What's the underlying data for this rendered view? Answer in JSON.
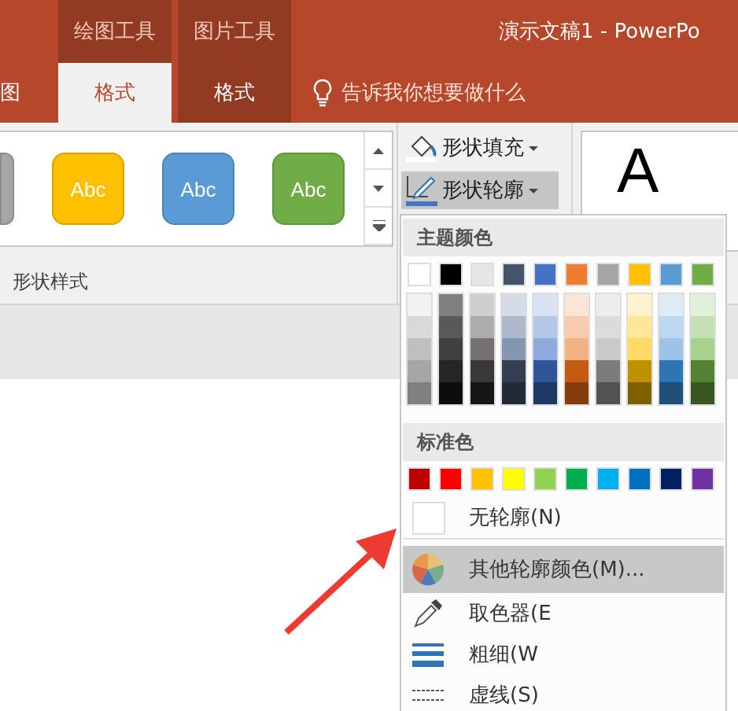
{
  "title_bar": {
    "tool_groups": [
      "绘图工具",
      "图片工具"
    ],
    "title": "演示文稿1  -  PowerPo"
  },
  "tabs": [
    {
      "label": "图",
      "selected": false,
      "kind": "plain"
    },
    {
      "label": "格式",
      "selected": true,
      "kind": "context"
    },
    {
      "label": "格式",
      "selected": false,
      "kind": "context"
    }
  ],
  "tell_me": {
    "placeholder": "告诉我你想要做什么"
  },
  "shape_styles": {
    "items": [
      {
        "color": "#a5a5a5"
      },
      {
        "label": "Abc",
        "color": "#ffc000"
      },
      {
        "label": "Abc",
        "color": "#5b9bd5"
      },
      {
        "label": "Abc",
        "color": "#70ad47"
      }
    ],
    "group_label": "形状样式"
  },
  "shape_buttons": [
    {
      "label": "形状填充",
      "kind": "fill",
      "selected": false
    },
    {
      "label": "形状轮廓",
      "kind": "outline",
      "selected": true
    }
  ],
  "wordart": [
    "A"
  ],
  "outline_menu": {
    "theme_header": "主题颜色",
    "theme_colors": [
      {
        "color": "#ffffff",
        "shades": [
          {
            "color": "#f2f2f2"
          },
          {
            "color": "#d9d9d9"
          },
          {
            "color": "#bfbfbf"
          },
          {
            "color": "#a6a6a6"
          },
          {
            "color": "#808080"
          }
        ]
      },
      {
        "color": "#000000",
        "shades": [
          {
            "color": "#7f7f7f"
          },
          {
            "color": "#595959"
          },
          {
            "color": "#404040"
          },
          {
            "color": "#262626"
          },
          {
            "color": "#0d0d0d"
          }
        ]
      },
      {
        "color": "#e7e6e6",
        "shades": [
          {
            "color": "#d0cece"
          },
          {
            "color": "#aeabab"
          },
          {
            "color": "#757171"
          },
          {
            "color": "#3a3838"
          },
          {
            "color": "#171616"
          }
        ]
      },
      {
        "color": "#44546a",
        "shades": [
          {
            "color": "#d6dce5"
          },
          {
            "color": "#adb9ca"
          },
          {
            "color": "#8497b0"
          },
          {
            "color": "#333f50"
          },
          {
            "color": "#222a35"
          }
        ]
      },
      {
        "color": "#4472c4",
        "shades": [
          {
            "color": "#dae3f3"
          },
          {
            "color": "#b4c7e7"
          },
          {
            "color": "#8faadc"
          },
          {
            "color": "#2f5597"
          },
          {
            "color": "#203864"
          }
        ]
      },
      {
        "color": "#ed7d31",
        "shades": [
          {
            "color": "#fbe5d6"
          },
          {
            "color": "#f8cbad"
          },
          {
            "color": "#f4b183"
          },
          {
            "color": "#c55a11"
          },
          {
            "color": "#843c0c"
          }
        ]
      },
      {
        "color": "#a5a5a5",
        "shades": [
          {
            "color": "#ededed"
          },
          {
            "color": "#dbdbdb"
          },
          {
            "color": "#c9c9c9"
          },
          {
            "color": "#7b7b7b"
          },
          {
            "color": "#525252"
          }
        ]
      },
      {
        "color": "#ffc000",
        "shades": [
          {
            "color": "#fff2cc"
          },
          {
            "color": "#ffe699"
          },
          {
            "color": "#ffd966"
          },
          {
            "color": "#bf9000"
          },
          {
            "color": "#7f6000"
          }
        ]
      },
      {
        "color": "#5b9bd5",
        "shades": [
          {
            "color": "#deebf7"
          },
          {
            "color": "#bdd7ee"
          },
          {
            "color": "#9dc3e6"
          },
          {
            "color": "#2e75b6"
          },
          {
            "color": "#1f4e79"
          }
        ]
      },
      {
        "color": "#70ad47",
        "shades": [
          {
            "color": "#e2f0d9"
          },
          {
            "color": "#c5e0b4"
          },
          {
            "color": "#a9d18e"
          },
          {
            "color": "#548235"
          },
          {
            "color": "#385723"
          }
        ]
      }
    ],
    "standard_header": "标准色",
    "standard_colors": [
      {
        "color": "#c00000"
      },
      {
        "color": "#ff0000"
      },
      {
        "color": "#ffc000"
      },
      {
        "color": "#ffff00"
      },
      {
        "color": "#92d050"
      },
      {
        "color": "#00b050"
      },
      {
        "color": "#00b0f0"
      },
      {
        "color": "#0070c0"
      },
      {
        "color": "#002060"
      },
      {
        "color": "#7030a0"
      }
    ],
    "items": [
      {
        "kind": "none",
        "label": "无轮廓(N)",
        "selected": false
      },
      {
        "kind": "more",
        "label": "其他轮廓颜色(M)...",
        "selected": true
      },
      {
        "kind": "eyedropper",
        "label": "取色器(E",
        "selected": false
      },
      {
        "kind": "weight",
        "label": "粗细(W",
        "selected": false
      },
      {
        "kind": "dash",
        "label": "虚线(S)",
        "selected": false
      }
    ]
  }
}
